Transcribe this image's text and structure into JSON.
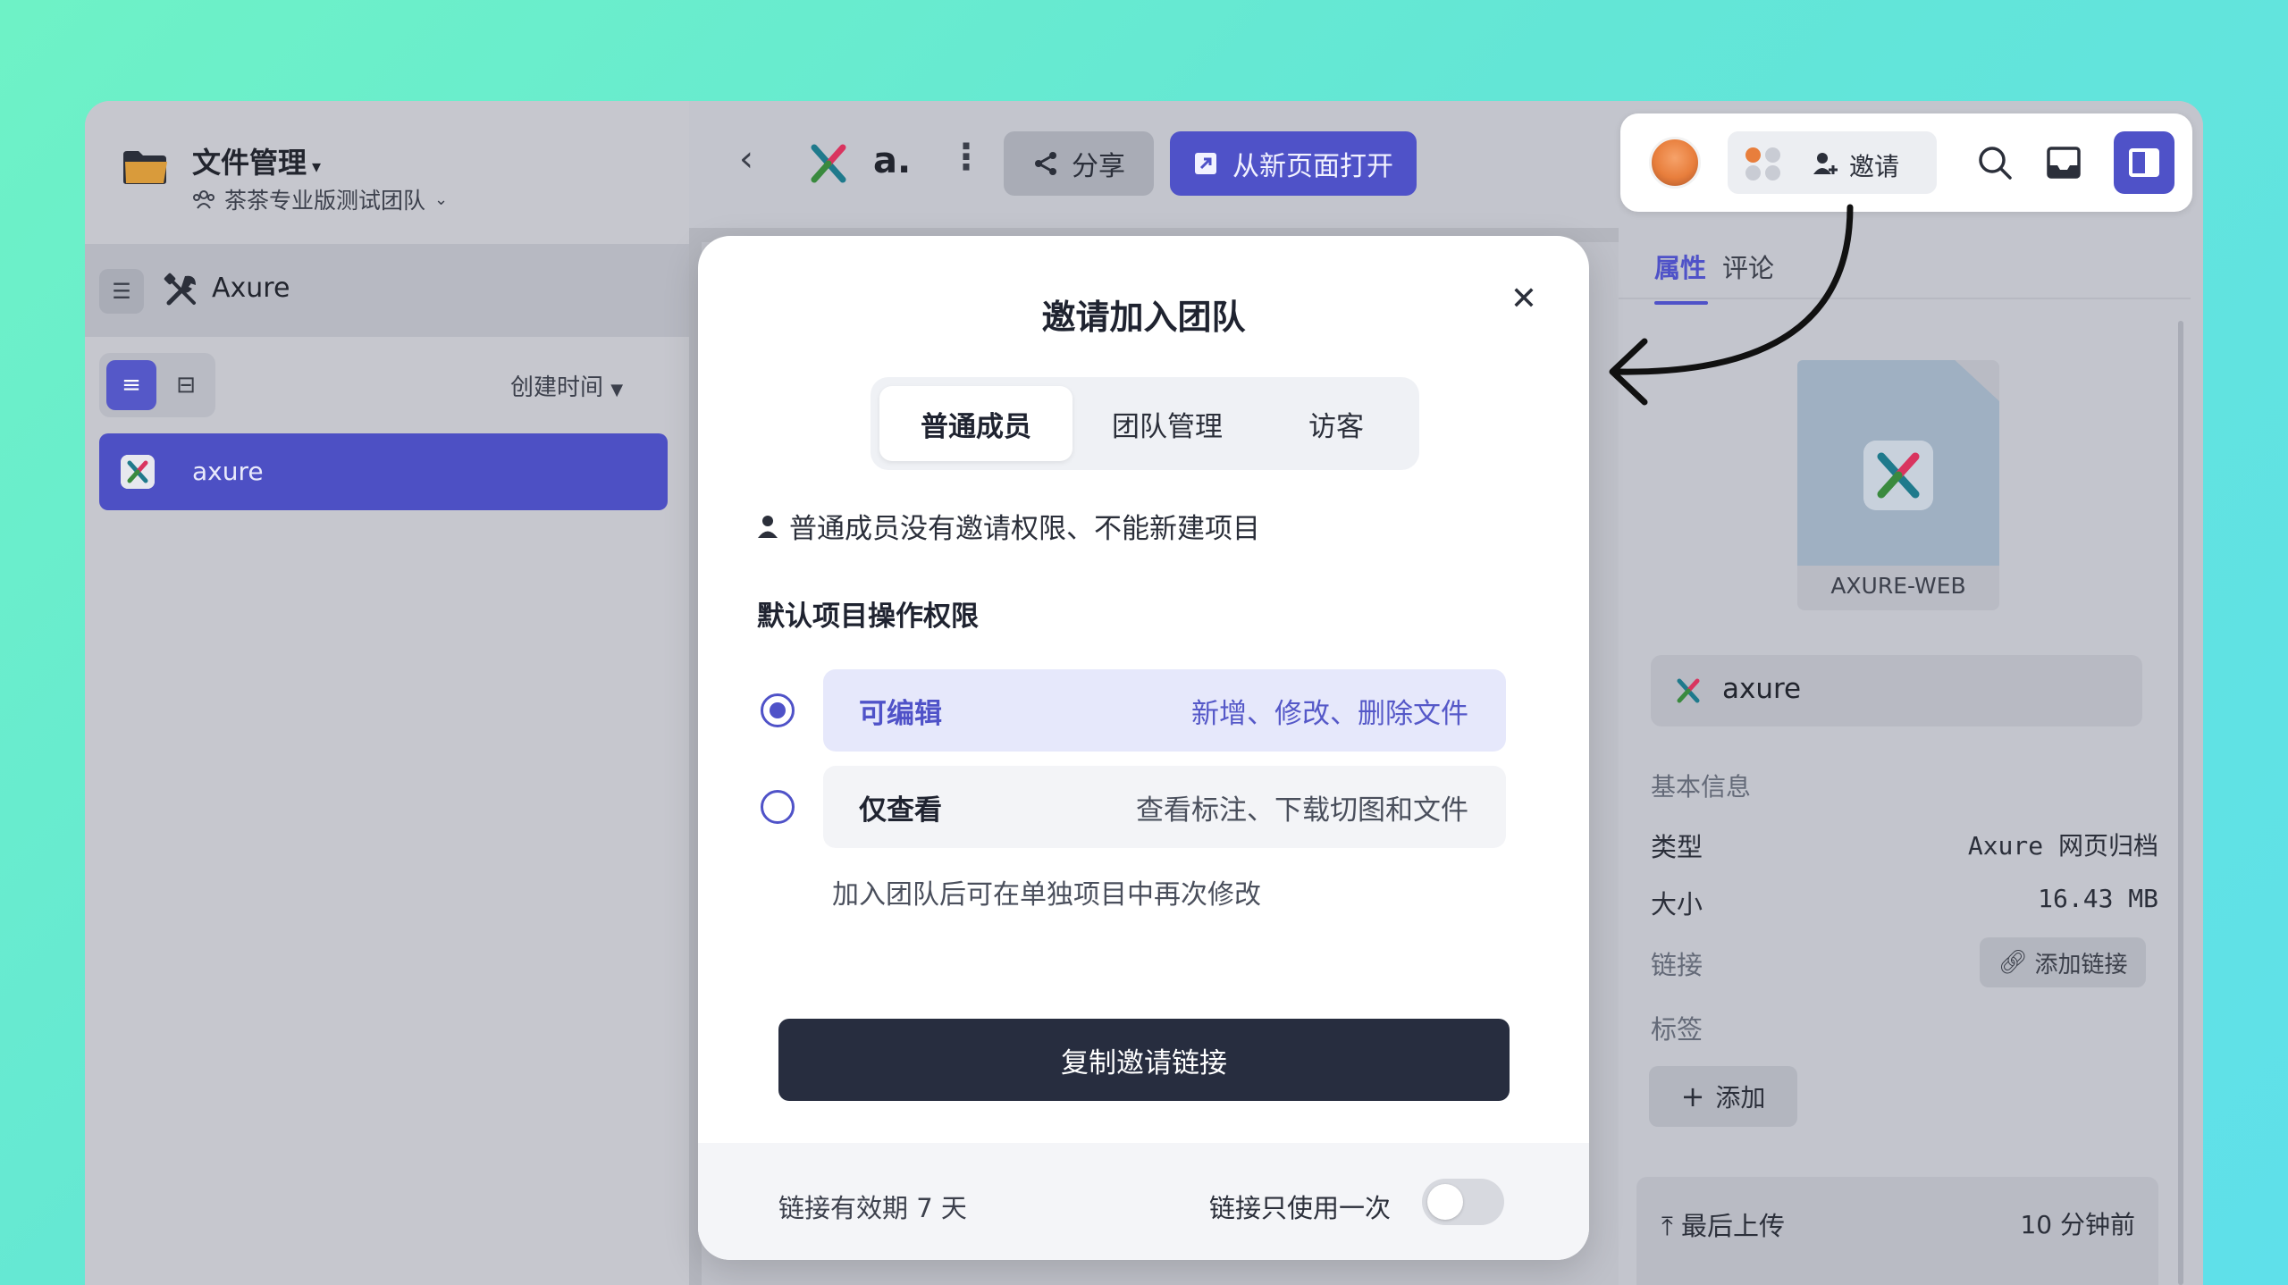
{
  "sidebar": {
    "title": "文件管理",
    "team": "茶茶专业版测试团队",
    "project_name": "Axure",
    "sort_label": "创建时间",
    "files": [
      {
        "name": "axure"
      }
    ]
  },
  "toolbar": {
    "doc_name": "a.",
    "share_label": "分享",
    "open_label": "从新页面打开"
  },
  "right_panel": {
    "invite_label": "邀请",
    "tabs": [
      {
        "label": "属性"
      },
      {
        "label": "评论"
      }
    ],
    "thumb_label": "AXURE-WEB",
    "file_name": "axure",
    "basic_info": "基本信息",
    "rows": [
      {
        "label": "类型",
        "value": "Axure 网页归档"
      },
      {
        "label": "大小",
        "value": "16.43 MB"
      }
    ],
    "link_label": "链接",
    "add_link_label": "添加链接",
    "tags_label": "标签",
    "add_tag_label": "添加",
    "last_upload_label": "最后上传",
    "last_upload_value": "10 分钟前"
  },
  "modal": {
    "title": "邀请加入团队",
    "tabs": [
      {
        "label": "普通成员"
      },
      {
        "label": "团队管理"
      },
      {
        "label": "访客"
      }
    ],
    "active_tab": 0,
    "note": "普通成员没有邀请权限、不能新建项目",
    "section_title": "默认项目操作权限",
    "options": [
      {
        "label": "可编辑",
        "desc": "新增、修改、删除文件",
        "selected": true
      },
      {
        "label": "仅查看",
        "desc": "查看标注、下载切图和文件",
        "selected": false
      }
    ],
    "hint": "加入团队后可在单独项目中再次修改",
    "copy_button": "复制邀请链接",
    "footer_left": "链接有效期 7 天",
    "footer_right": "链接只使用一次",
    "once_toggle_on": false
  },
  "colors": {
    "accent": "#4f52c8",
    "dark_button": "#272d3f",
    "background_gradient_start": "#6ef2c6",
    "background_gradient_end": "#5fe0ea"
  },
  "icons": [
    "folder-icon",
    "team-icon",
    "collapse-icon",
    "tools-icon",
    "list-view-icon",
    "grid-view-icon",
    "axure-x-icon",
    "back-icon",
    "more-icon",
    "share-icon",
    "open-external-icon",
    "avatar",
    "invite-icon",
    "search-icon",
    "inbox-icon",
    "panel-toggle-icon",
    "close-icon",
    "user-icon",
    "link-icon",
    "plus-icon",
    "upload-icon"
  ]
}
